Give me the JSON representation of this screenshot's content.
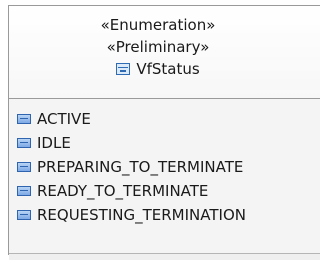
{
  "enumeration": {
    "stereotype_1": "«Enumeration»",
    "stereotype_2": "«Preliminary»",
    "name": "VfStatus",
    "literals": [
      "ACTIVE",
      "IDLE",
      "PREPARING_TO_TERMINATE",
      "READY_TO_TERMINATE",
      "REQUESTING_TERMINATION"
    ]
  }
}
